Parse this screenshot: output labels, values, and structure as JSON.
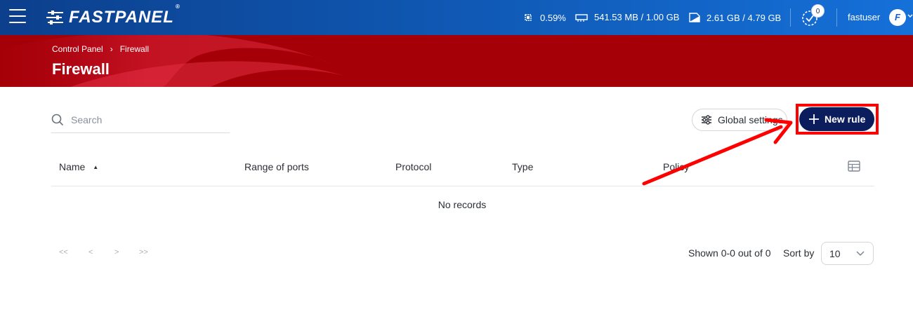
{
  "topbar": {
    "logo_text": "FASTPANEL",
    "logo_reg": "®",
    "cpu": "0.59%",
    "memory": "541.53 MB / 1.00 GB",
    "disk": "2.61 GB / 4.79 GB",
    "tasks_count": "0",
    "username": "fastuser",
    "avatar_letter": "F"
  },
  "header": {
    "breadcrumb": [
      "Control Panel",
      "Firewall"
    ],
    "breadcrumb_sep": "›",
    "title": "Firewall",
    "brand_color": "#a50008"
  },
  "toolbar": {
    "search_placeholder": "Search",
    "global_settings_label": "Global settings",
    "new_rule_label": "New rule"
  },
  "table": {
    "columns": [
      "Name",
      "Range of ports",
      "Protocol",
      "Type",
      "Policy"
    ],
    "sort_indicator": "▲",
    "empty_text": "No records"
  },
  "pagination": {
    "first": "<<",
    "prev": "<",
    "next": ">",
    "last": ">>",
    "shown_text": "Shown 0-0 out of 0",
    "sort_by_label": "Sort by",
    "page_size": "10"
  },
  "colors": {
    "topbar_start": "#0c3f8c",
    "topbar_end": "#1570d8",
    "primary_button": "#0c1d5e",
    "annotation": "#ff0000"
  }
}
